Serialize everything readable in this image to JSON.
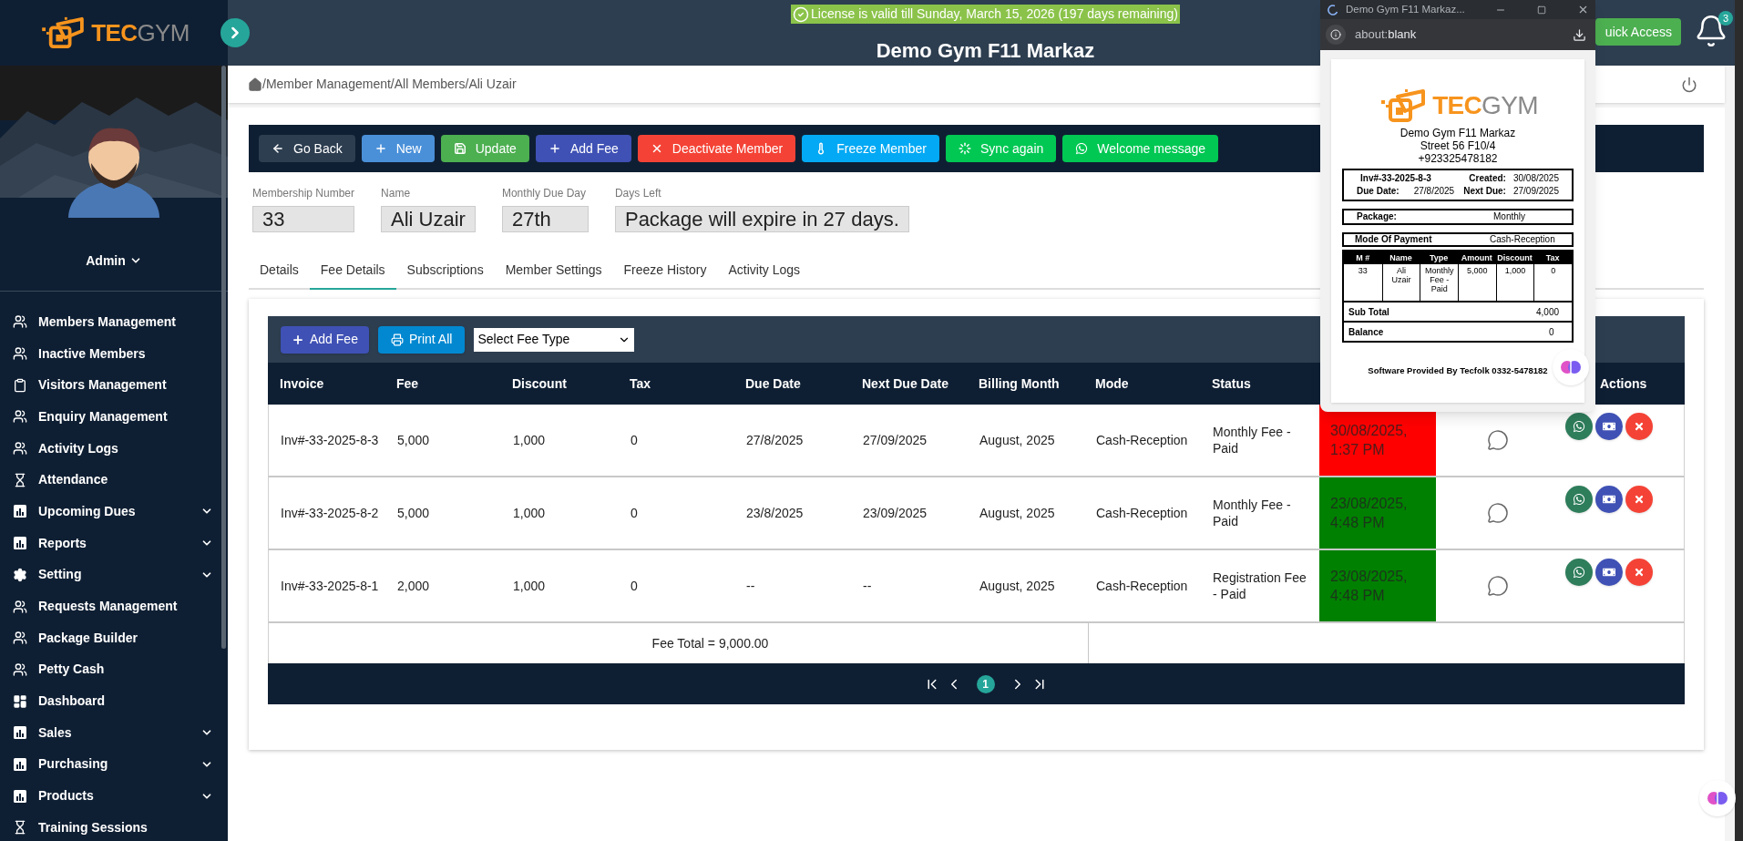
{
  "sidebar": {
    "logo": {
      "part_1": "TEC",
      "part_2": "GYM"
    },
    "user": "Admin",
    "items": [
      {
        "label": "Members Management",
        "submenu": false
      },
      {
        "label": "Inactive Members",
        "submenu": false
      },
      {
        "label": "Visitors Management",
        "submenu": false
      },
      {
        "label": "Enquiry Management",
        "submenu": false
      },
      {
        "label": "Activity Logs",
        "submenu": false
      },
      {
        "label": "Attendance",
        "submenu": false
      },
      {
        "label": "Upcoming Dues",
        "submenu": true
      },
      {
        "label": "Reports",
        "submenu": true
      },
      {
        "label": "Setting",
        "submenu": true
      },
      {
        "label": "Requests Management",
        "submenu": false
      },
      {
        "label": "Package Builder",
        "submenu": false
      },
      {
        "label": "Petty Cash",
        "submenu": false
      },
      {
        "label": "Dashboard",
        "submenu": false
      },
      {
        "label": "Sales",
        "submenu": true
      },
      {
        "label": "Purchasing",
        "submenu": true
      },
      {
        "label": "Products",
        "submenu": true
      },
      {
        "label": "Training Sessions",
        "submenu": false
      }
    ]
  },
  "header": {
    "license": "License is valid till Sunday, March 15, 2026 (197 days remaining)",
    "title": "Demo Gym F11 Markaz",
    "quick_access": "uick Access",
    "notifications": "3"
  },
  "breadcrumb": [
    "/Member Management",
    "/All Members",
    "/Ali Uzair"
  ],
  "actions": [
    {
      "label": "Go Back",
      "color": "#2d3e50"
    },
    {
      "label": "New",
      "color": "#4a90d9"
    },
    {
      "label": "Update",
      "color": "#4caf50"
    },
    {
      "label": "Add Fee",
      "color": "#3f51b5"
    },
    {
      "label": "Deactivate Member",
      "color": "#f44336"
    },
    {
      "label": "Freeze Member",
      "color": "#03a9f4"
    },
    {
      "label": "Sync again",
      "color": "#00c853"
    },
    {
      "label": "Welcome message",
      "color": "#00c853"
    }
  ],
  "member": [
    {
      "label": "Membership Number",
      "value": "33"
    },
    {
      "label": "Name",
      "value": "Ali Uzair"
    },
    {
      "label": "Monthly Due Day",
      "value": "27th"
    },
    {
      "label": "Days Left",
      "value": "Package will expire in 27 days."
    }
  ],
  "tabs": [
    {
      "label": "Details",
      "selected": false
    },
    {
      "label": "Fee Details",
      "selected": true
    },
    {
      "label": "Subscriptions",
      "selected": false
    },
    {
      "label": "Member Settings",
      "selected": false
    },
    {
      "label": "Freeze History",
      "selected": false
    },
    {
      "label": "Activity Logs",
      "selected": false
    }
  ],
  "fee_toolbar": {
    "add": "Add Fee",
    "print": "Print All",
    "select": "Select Fee Type"
  },
  "table": {
    "columns": [
      "Invoice",
      "Fee",
      "Discount",
      "Tax",
      "Due Date",
      "Next Due Date",
      "Billing Month",
      "Mode",
      "Status",
      "Actions"
    ],
    "rows": [
      {
        "invoice": "Inv#-33-2025-8-3",
        "fee": "5,000",
        "discount": "1,000",
        "tax": "0",
        "due": "27/8/2025",
        "next_due": "27/09/2025",
        "month": "August, 2025",
        "mode": "Cash-Reception",
        "status": "Monthly Fee - Paid",
        "paid_on": "30/08/2025, 1:37 PM",
        "color": "#ff0000"
      },
      {
        "invoice": "Inv#-33-2025-8-2",
        "fee": "5,000",
        "discount": "1,000",
        "tax": "0",
        "due": "23/8/2025",
        "next_due": "23/09/2025",
        "month": "August, 2025",
        "mode": "Cash-Reception",
        "status": "Monthly Fee - Paid",
        "paid_on": "23/08/2025, 4:48 PM",
        "color": "#008000"
      },
      {
        "invoice": "Inv#-33-2025-8-1",
        "fee": "2,000",
        "discount": "1,000",
        "tax": "0",
        "due": "--",
        "next_due": "--",
        "month": "August, 2025",
        "mode": "Cash-Reception",
        "status": "Registration Fee - Paid",
        "paid_on": "23/08/2025, 4:48 PM",
        "color": "#008000"
      }
    ],
    "total": "Fee Total = 9,000.00",
    "page": "1"
  },
  "popup": {
    "title": "Demo Gym F11 Markaz...",
    "address_1": "about:",
    "address_2": "blank",
    "receipt": {
      "logo": {
        "part_1": "TEC",
        "part_2": "GYM"
      },
      "address": [
        "Demo Gym F11 Markaz",
        "Street 56 F10/4",
        "+923325478182"
      ],
      "invoice": "Inv#-33-2025-8-3",
      "created_label": "Created:",
      "created": "30/08/2025",
      "due_label": "Due Date:",
      "due": "27/8/2025",
      "next_label": "Next Due:",
      "next": "27/09/2025",
      "package_label": "Package:",
      "package": "Monthly",
      "mode_label": "Mode Of Payment",
      "mode": "Cash-Reception",
      "columns": [
        "M #",
        "Name",
        "Type",
        "Amount",
        "Discount",
        "Tax"
      ],
      "row": [
        "33",
        "Ali Uzair",
        "Monthly Fee - Paid",
        "5,000",
        "1,000",
        "0"
      ],
      "subtotal_label": "Sub Total",
      "subtotal": "4,000",
      "balance_label": "Balance",
      "balance": "0",
      "footer": "Software Provided By Tecfolk 0332-5478182"
    }
  }
}
